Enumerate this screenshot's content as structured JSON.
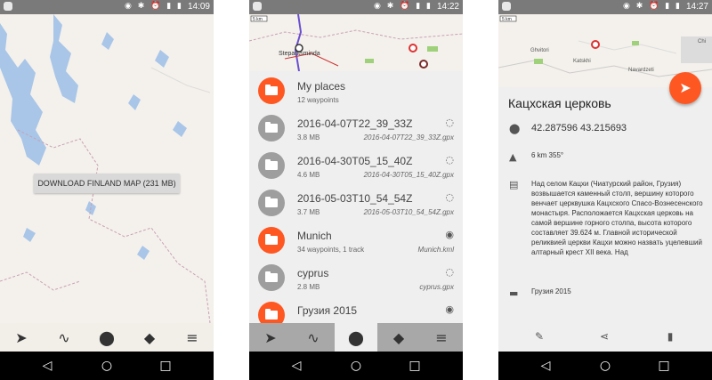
{
  "status": {
    "time1": "14:09",
    "time2": "14:22",
    "time3": "14:27",
    "icons": "◉ ✱ ⏰ ▮ ▮"
  },
  "nav": {
    "back": "◁",
    "home": "○",
    "recent": "□"
  },
  "screen1": {
    "download_label": "DOWNLOAD FINLAND MAP (231 MB)",
    "toolbar": {
      "location": "➤",
      "tracks": "∿",
      "places": "⬤",
      "layers": "◆",
      "menu": "≡"
    }
  },
  "screen2": {
    "map_labels": {
      "scale": "5 km",
      "town": "Stepantsminda"
    },
    "rows": [
      {
        "name": "My places",
        "sub": "12 waypoints",
        "file": "",
        "vis": "",
        "color": "orange"
      },
      {
        "name": "2016-04-07T22_39_33Z",
        "sub": "3.8 MB",
        "file": "2016-04-07T22_39_33Z.gpx",
        "vis": "◌",
        "color": "gray"
      },
      {
        "name": "2016-04-30T05_15_40Z",
        "sub": "4.6 MB",
        "file": "2016-04-30T05_15_40Z.gpx",
        "vis": "◌",
        "color": "gray"
      },
      {
        "name": "2016-05-03T10_54_54Z",
        "sub": "3.7 MB",
        "file": "2016-05-03T10_54_54Z.gpx",
        "vis": "◌",
        "color": "gray"
      },
      {
        "name": "Munich",
        "sub": "34 waypoints, 1 track",
        "file": "Munich.kml",
        "vis": "◉",
        "color": "orange"
      },
      {
        "name": "cyprus",
        "sub": "2.8 MB",
        "file": "cyprus.gpx",
        "vis": "◌",
        "color": "gray"
      },
      {
        "name": "Грузия 2015",
        "sub": "",
        "file": "",
        "vis": "◉",
        "color": "orange"
      }
    ]
  },
  "screen3": {
    "map_labels": {
      "scale": "5 km",
      "town1": "Ghvitori",
      "town2": "Katskhi",
      "town3": "Navardzeti",
      "town4": "Chi"
    },
    "fab_icon": "➤",
    "title": "Кацхская церковь",
    "coords": "42.287596 43.215693",
    "distance": "6 km 355°",
    "description": "Над селом Кацхи (Чиатурский район, Грузия) возвышается каменный столп, вершину которого венчает церквушка Кацхского Спасо-Вознесенского монастыря. Расположается Кацхская церковь на самой вершине горного столпа, высота которого составляет 39.624 м. Главной исторической реликвией церкви Кацхи можно назвать уцелевший алтарный крест XII века. Над",
    "folder": "Грузия 2015",
    "icons": {
      "pin": "⬤",
      "nav": "▲",
      "doc": "▤",
      "folder": "▬",
      "edit": "✎",
      "share": "⋖",
      "delete": "▮"
    }
  },
  "colors": {
    "accent": "#ff5722",
    "statusbar": "#7a7a7a",
    "list_bg": "#efefef",
    "map_bg": "#f2efe9"
  }
}
